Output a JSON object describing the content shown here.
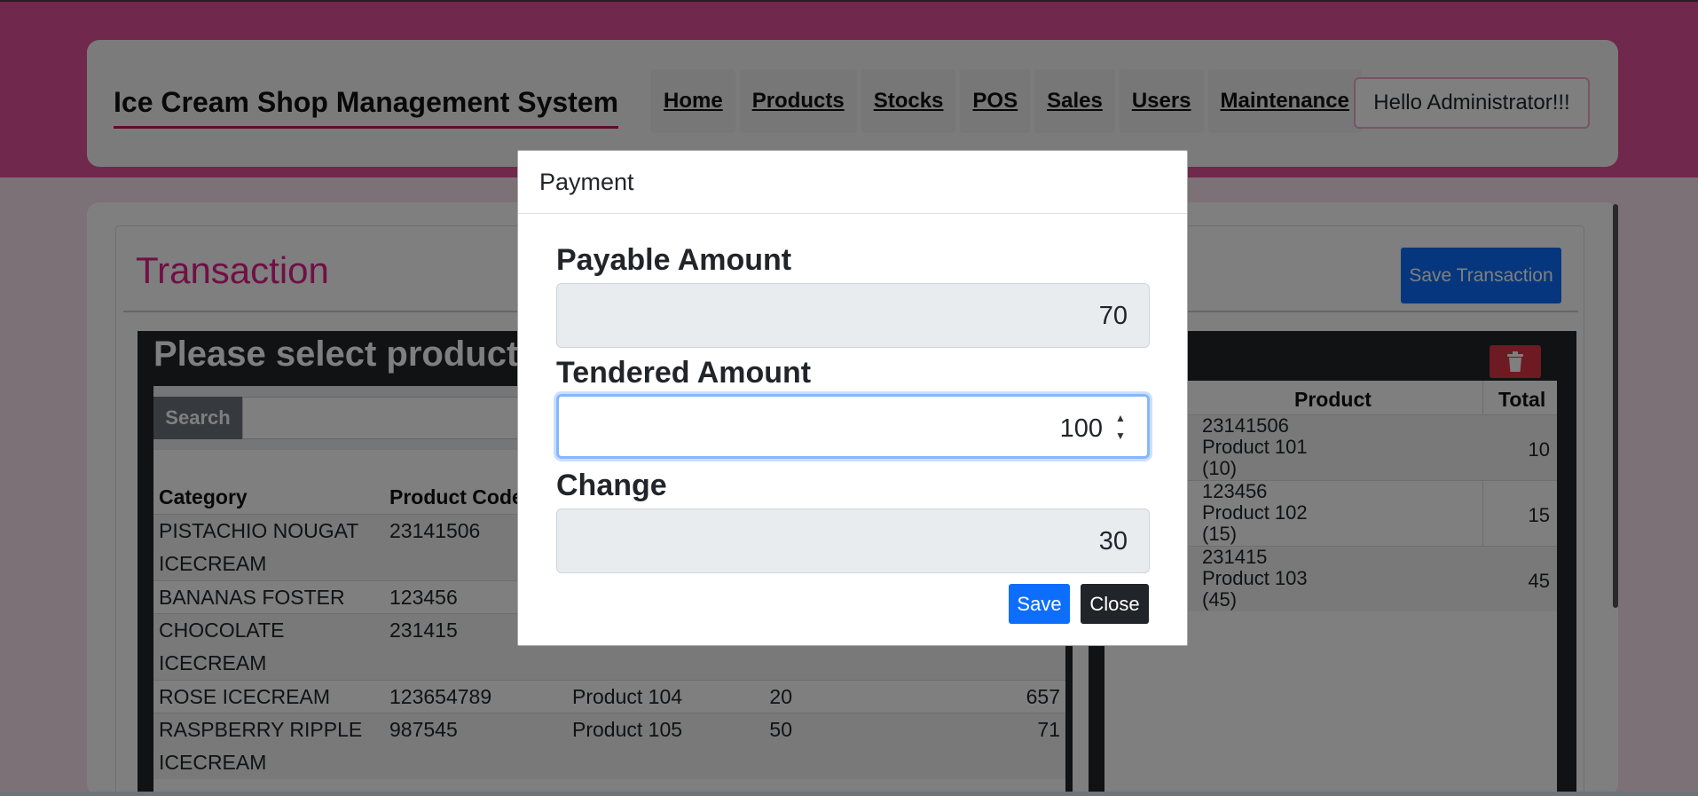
{
  "header": {
    "brand": "Ice Cream Shop Management System",
    "nav": [
      "Home",
      "Products",
      "Stocks",
      "POS",
      "Sales",
      "Users",
      "Maintenance"
    ],
    "greeting": "Hello Administrator!!!"
  },
  "transaction": {
    "title": "Transaction",
    "save_button": "Save Transaction",
    "product_panel_heading": "Please select product",
    "search_label": "Search",
    "columns": [
      "Category",
      "Product Code"
    ],
    "products": [
      {
        "category": [
          "PISTACHIO NOUGAT",
          "ICECREAM"
        ],
        "code": "23141506",
        "name": "",
        "price": "",
        "stock": ""
      },
      {
        "category": [
          "BANANAS FOSTER"
        ],
        "code": "123456",
        "name": "",
        "price": "",
        "stock": ""
      },
      {
        "category": [
          "CHOCOLATE",
          "ICECREAM"
        ],
        "code": "231415",
        "name": "",
        "price": "",
        "stock": ""
      },
      {
        "category": [
          "ROSE ICECREAM"
        ],
        "code": "123654789",
        "name": "Product 104",
        "price": "20",
        "stock": "657"
      },
      {
        "category": [
          "RASPBERRY RIPPLE",
          "ICECREAM"
        ],
        "code": "987545",
        "name": "Product 105",
        "price": "50",
        "stock": "71"
      }
    ],
    "cart_columns": [
      "Product",
      "Total"
    ],
    "cart": [
      {
        "line1": "23141506",
        "line2": "Product 101",
        "line3": "(10)",
        "total": "10"
      },
      {
        "line1": "123456",
        "line2": "Product 102",
        "line3": "(15)",
        "total": "15"
      },
      {
        "line1": "231415",
        "line2": "Product 103",
        "line3": "(45)",
        "total": "45"
      }
    ]
  },
  "modal": {
    "title": "Payment",
    "payable_label": "Payable Amount",
    "payable_value": "70",
    "tendered_label": "Tendered Amount",
    "tendered_value": "100",
    "change_label": "Change",
    "change_value": "30",
    "save_label": "Save",
    "close_label": "Close"
  },
  "colors": {
    "brand_pink": "#e1509a",
    "title_pink": "#e0218a",
    "primary": "#0d6efd",
    "danger": "#dc3545",
    "dark": "#212529"
  }
}
